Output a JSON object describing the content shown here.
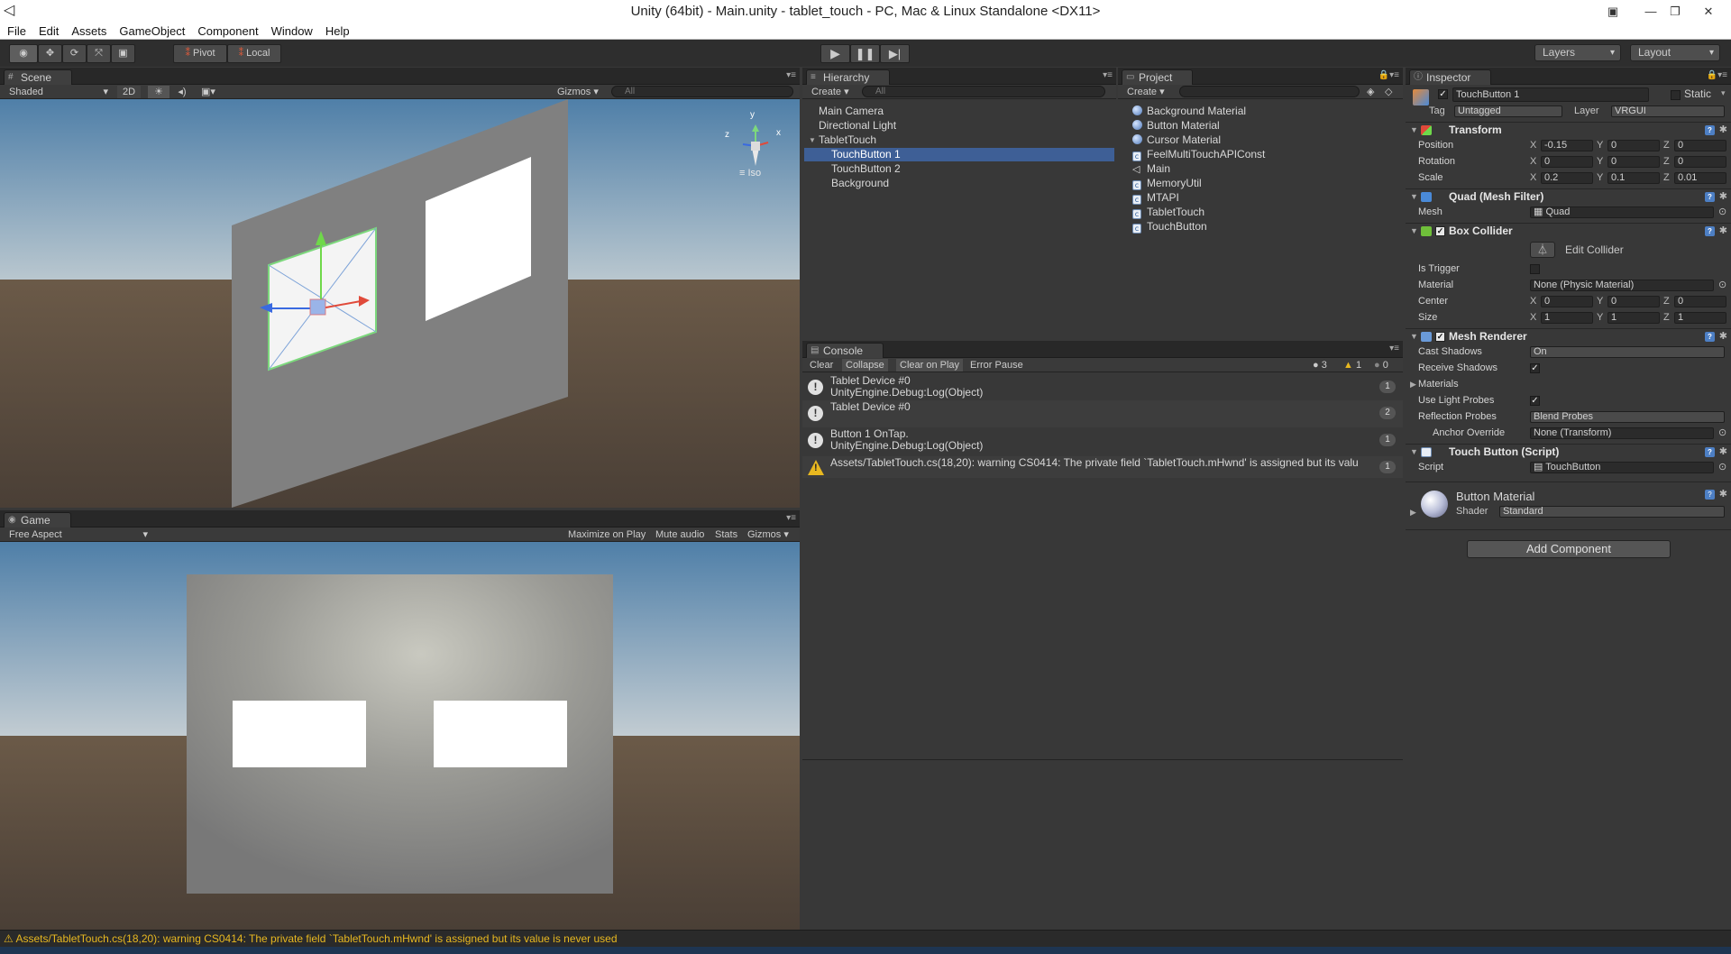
{
  "window": {
    "title": "Unity (64bit) - Main.unity - tablet_touch - PC, Mac & Linux Standalone <DX11>",
    "logo": "unity-logo",
    "controls": [
      "restore",
      "minimize",
      "maximize",
      "close"
    ]
  },
  "menu": [
    "File",
    "Edit",
    "Assets",
    "GameObject",
    "Component",
    "Window",
    "Help"
  ],
  "toolbar": {
    "tools": [
      "view-tool",
      "move-tool",
      "rotate-tool",
      "scale-tool",
      "rect-tool"
    ],
    "pivot": "Pivot",
    "local": "Local",
    "layers": "Layers",
    "layout": "Layout"
  },
  "scene": {
    "tab": "Scene",
    "shading": "Shaded",
    "mode2d": "2D",
    "gizmos": "Gizmos",
    "search_placeholder": "All",
    "iso": "Iso",
    "gizmo_axes": {
      "y": "y",
      "x": "x",
      "z": "z"
    }
  },
  "game": {
    "tab": "Game",
    "aspect": "Free Aspect",
    "maximize": "Maximize on Play",
    "mute": "Mute audio",
    "stats": "Stats",
    "gizmos": "Gizmos"
  },
  "hierarchy": {
    "tab": "Hierarchy",
    "create": "Create",
    "search_placeholder": "All",
    "items": [
      {
        "label": "Main Camera",
        "level": 0
      },
      {
        "label": "Directional Light",
        "level": 0
      },
      {
        "label": "TabletTouch",
        "level": 0,
        "expanded": true
      },
      {
        "label": "TouchButton 1",
        "level": 1,
        "selected": true
      },
      {
        "label": "TouchButton 2",
        "level": 1
      },
      {
        "label": "Background",
        "level": 1
      }
    ]
  },
  "project": {
    "tab": "Project",
    "create": "Create",
    "items": [
      {
        "label": "Background Material",
        "icon": "material-icon"
      },
      {
        "label": "Button Material",
        "icon": "material-icon"
      },
      {
        "label": "Cursor Material",
        "icon": "material-icon"
      },
      {
        "label": "FeelMultiTouchAPIConst",
        "icon": "script-icon"
      },
      {
        "label": "Main",
        "icon": "unity-scene-icon"
      },
      {
        "label": "MemoryUtil",
        "icon": "script-icon"
      },
      {
        "label": "MTAPI",
        "icon": "script-icon"
      },
      {
        "label": "TabletTouch",
        "icon": "script-icon"
      },
      {
        "label": "TouchButton",
        "icon": "script-icon"
      }
    ]
  },
  "console": {
    "tab": "Console",
    "buttons": [
      "Clear",
      "Collapse",
      "Clear on Play",
      "Error Pause"
    ],
    "counts": {
      "log": "3",
      "warn": "1",
      "error": "0"
    },
    "entries": [
      {
        "line1": "Tablet Device #0",
        "line2": "UnityEngine.Debug:Log(Object)",
        "count": "1",
        "type": "log"
      },
      {
        "line1": "Tablet Device #0",
        "line2": "",
        "count": "2",
        "type": "log"
      },
      {
        "line1": "Button 1 OnTap.",
        "line2": "UnityEngine.Debug:Log(Object)",
        "count": "1",
        "type": "log"
      },
      {
        "line1": "Assets/TabletTouch.cs(18,20): warning CS0414: The private field `TabletTouch.mHwnd' is assigned but its valu",
        "line2": "",
        "count": "1",
        "type": "warning"
      }
    ]
  },
  "inspector": {
    "tab": "Inspector",
    "object_name": "TouchButton 1",
    "static_label": "Static",
    "tag_label": "Tag",
    "tag": "Untagged",
    "layer_label": "Layer",
    "layer": "VRGUI",
    "transform": {
      "title": "Transform",
      "position_label": "Position",
      "position": {
        "x": "-0.15",
        "y": "0",
        "z": "0"
      },
      "rotation_label": "Rotation",
      "rotation": {
        "x": "0",
        "y": "0",
        "z": "0"
      },
      "scale_label": "Scale",
      "scale": {
        "x": "0.2",
        "y": "0.1",
        "z": "0.01"
      }
    },
    "mesh_filter": {
      "title": "Quad (Mesh Filter)",
      "mesh_label": "Mesh",
      "mesh": "Quad"
    },
    "box_collider": {
      "title": "Box Collider",
      "edit_collider": "Edit Collider",
      "is_trigger_label": "Is Trigger",
      "material_label": "Material",
      "material": "None (Physic Material)",
      "center_label": "Center",
      "center": {
        "x": "0",
        "y": "0",
        "z": "0"
      },
      "size_label": "Size",
      "size": {
        "x": "1",
        "y": "1",
        "z": "1"
      }
    },
    "mesh_renderer": {
      "title": "Mesh Renderer",
      "cast_shadows_label": "Cast Shadows",
      "cast_shadows": "On",
      "receive_shadows_label": "Receive Shadows",
      "materials_label": "Materials",
      "use_light_probes_label": "Use Light Probes",
      "reflection_probes_label": "Reflection Probes",
      "reflection_probes": "Blend Probes",
      "anchor_override_label": "Anchor Override",
      "anchor_override": "None (Transform)"
    },
    "touch_button": {
      "title": "Touch Button (Script)",
      "script_label": "Script",
      "script": "TouchButton"
    },
    "material": {
      "name": "Button Material",
      "shader_label": "Shader",
      "shader": "Standard"
    },
    "add_component": "Add Component"
  },
  "status": {
    "message": "Assets/TabletTouch.cs(18,20): warning CS0414: The private field `TabletTouch.mHwnd' is assigned but its value is never used"
  },
  "colors": {
    "selection": "#3e5f96",
    "warning": "#e8b820",
    "panel": "#383838"
  }
}
